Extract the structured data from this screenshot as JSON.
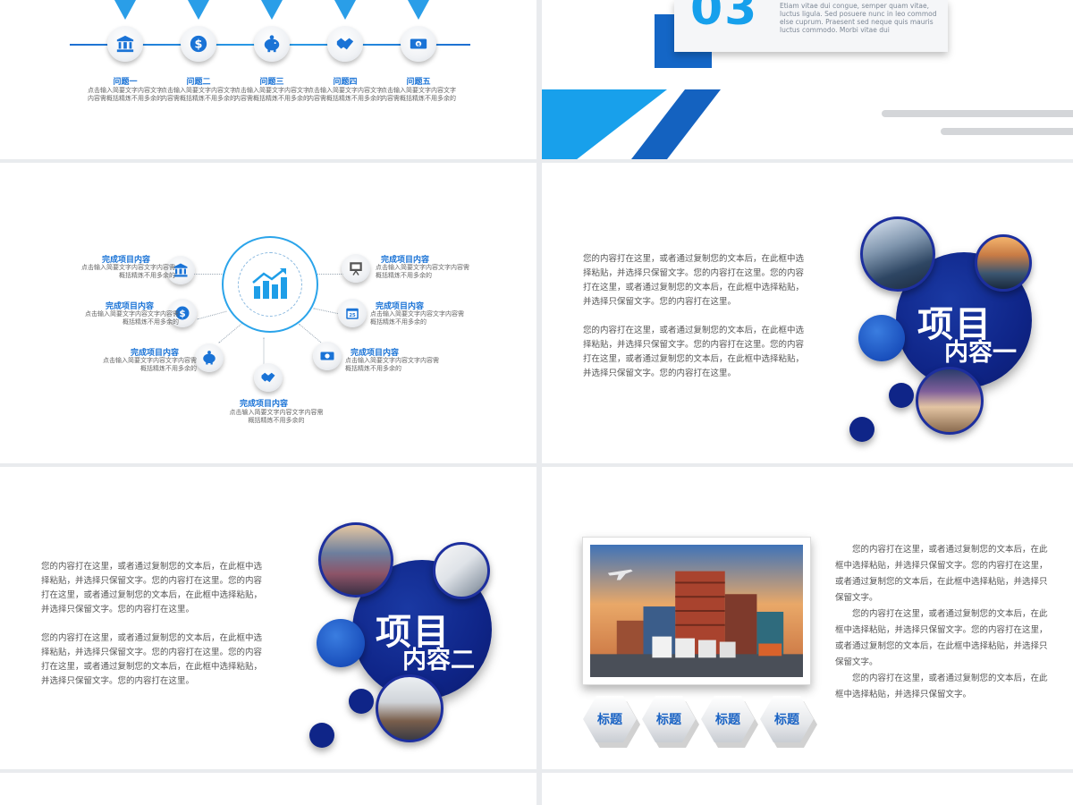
{
  "colors": {
    "accent_light": "#18a0eb",
    "accent_dark": "#1462c0",
    "navy": "#0f2588",
    "title_blue": "#1a73d6"
  },
  "slide1": {
    "steps": [
      {
        "title": "问题一",
        "icon": "bank-icon",
        "desc": "点击输入简要文字内容文字内容需概括精炼不用多余的"
      },
      {
        "title": "问题二",
        "icon": "globe-dollar-icon",
        "desc": "点击输入简要文字内容文字内容需概括精炼不用多余的"
      },
      {
        "title": "问题三",
        "icon": "piggy-bank-icon",
        "desc": "点击输入简要文字内容文字内容需概括精炼不用多余的"
      },
      {
        "title": "问题四",
        "icon": "handshake-icon",
        "desc": "点击输入简要文字内容文字内容需概括精炼不用多余的"
      },
      {
        "title": "问题五",
        "icon": "money-icon",
        "desc": "点击输入简要文字内容文字内容需概括精炼不用多余的"
      }
    ]
  },
  "slide2": {
    "number": "03",
    "latin": "Etiam vitae dui congue, semper quam vitae, luctus ligula. Sed posuere nunc in leo commod else cuprum. Praesent sed neque quis mauris luctus commodo. Morbi vitae dui"
  },
  "slide3": {
    "hub_icon": "growth-chart-icon",
    "items": [
      {
        "title": "完成项目内容",
        "desc": "点击输入简要文字内容文字内容需概括精炼不用多余的",
        "icon": "bank-icon"
      },
      {
        "title": "完成项目内容",
        "desc": "点击输入简要文字内容文字内容需概括精炼不用多余的",
        "icon": "globe-dollar-icon"
      },
      {
        "title": "完成项目内容",
        "desc": "点击输入简要文字内容文字内容需概括精炼不用多余的",
        "icon": "piggy-bank-icon"
      },
      {
        "title": "完成项目内容",
        "desc": "点击输入简要文字内容文字内容需概括精炼不用多余的",
        "icon": "handshake-icon"
      },
      {
        "title": "完成项目内容",
        "desc": "点击输入简要文字内容文字内容需概括精炼不用多余的",
        "icon": "presentation-icon"
      },
      {
        "title": "完成项目内容",
        "desc": "点击输入简要文字内容文字内容需概括精炼不用多余的",
        "icon": "calendar-icon"
      },
      {
        "title": "完成项目内容",
        "desc": "点击输入简要文字内容文字内容需概括精炼不用多余的",
        "icon": "money-icon"
      }
    ]
  },
  "slide4": {
    "para1": "您的内容打在这里，或者通过复制您的文本后，在此框中选择粘贴，并选择只保留文字。您的内容打在这里。您的内容打在这里，或者通过复制您的文本后，在此框中选择粘贴，并选择只保留文字。您的内容打在这里。",
    "para2": "您的内容打在这里，或者通过复制您的文本后，在此框中选择粘贴，并选择只保留文字。您的内容打在这里。您的内容打在这里，或者通过复制您的文本后，在此框中选择粘贴，并选择只保留文字。您的内容打在这里。",
    "circle_title": "项目",
    "circle_sub": "内容一"
  },
  "slide5": {
    "para1": "您的内容打在这里，或者通过复制您的文本后，在此框中选择粘贴，并选择只保留文字。您的内容打在这里。您的内容打在这里，或者通过复制您的文本后，在此框中选择粘贴，并选择只保留文字。您的内容打在这里。",
    "para2": "您的内容打在这里，或者通过复制您的文本后，在此框中选择粘贴，并选择只保留文字。您的内容打在这里。您的内容打在这里，或者通过复制您的文本后，在此框中选择粘贴，并选择只保留文字。您的内容打在这里。",
    "circle_title": "项目",
    "circle_sub": "内容二"
  },
  "slide6": {
    "tags": [
      "标题",
      "标题",
      "标题",
      "标题"
    ],
    "para1": "您的内容打在这里，或者通过复制您的文本后，在此框中选择粘贴，并选择只保留文字。您的内容打在这里，或者通过复制您的文本后，在此框中选择粘贴，并选择只保留文字。",
    "para2": "您的内容打在这里，或者通过复制您的文本后，在此框中选择粘贴，并选择只保留文字。您的内容打在这里，或者通过复制您的文本后，在此框中选择粘贴，并选择只保留文字。",
    "para3": "您的内容打在这里，或者通过复制您的文本后，在此框中选择粘贴，并选择只保留文字。"
  }
}
